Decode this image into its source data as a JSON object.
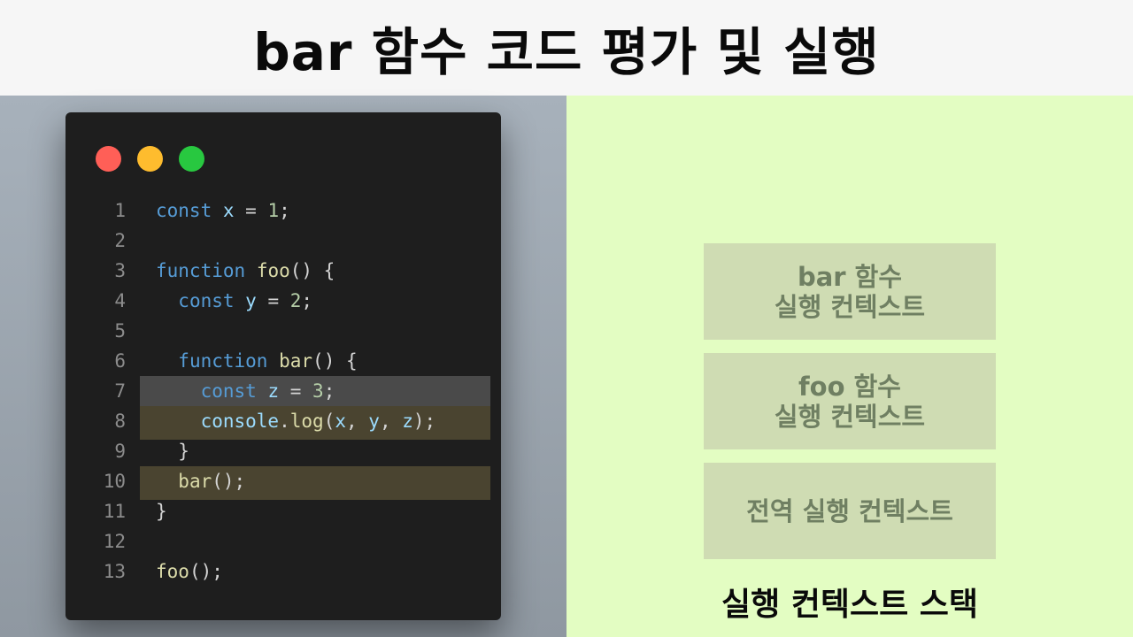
{
  "header": {
    "title": "bar 함수 코드 평가 및 실행"
  },
  "colors": {
    "header_bg": "#f6f6f6",
    "left_panel_bg": "#a0aab4",
    "editor_bg": "#1e1e1e",
    "right_panel_bg": "#e3fdc2",
    "stack_box_bg": "#cfdcb3",
    "stack_box_text": "#6f7f62",
    "highlight_current": "#4a4a4a",
    "highlight_pending": "#4a4430"
  },
  "editor": {
    "window_buttons": [
      {
        "name": "close-dot",
        "color": "#ff5f57"
      },
      {
        "name": "minimize-dot",
        "color": "#febc2e"
      },
      {
        "name": "maximize-dot",
        "color": "#28c840"
      }
    ],
    "lines": [
      {
        "num": "1",
        "highlight": "",
        "tokens": [
          [
            "kw",
            "const"
          ],
          [
            "pn",
            " "
          ],
          [
            "var",
            "x"
          ],
          [
            "pn",
            " = "
          ],
          [
            "numl",
            "1"
          ],
          [
            "pn",
            ";"
          ]
        ]
      },
      {
        "num": "2",
        "highlight": "",
        "tokens": []
      },
      {
        "num": "3",
        "highlight": "",
        "tokens": [
          [
            "kw",
            "function"
          ],
          [
            "pn",
            " "
          ],
          [
            "fn",
            "foo"
          ],
          [
            "pn",
            "() {"
          ]
        ]
      },
      {
        "num": "4",
        "highlight": "",
        "tokens": [
          [
            "pn",
            "  "
          ],
          [
            "kw",
            "const"
          ],
          [
            "pn",
            " "
          ],
          [
            "var",
            "y"
          ],
          [
            "pn",
            " = "
          ],
          [
            "numl",
            "2"
          ],
          [
            "pn",
            ";"
          ]
        ]
      },
      {
        "num": "5",
        "highlight": "",
        "tokens": []
      },
      {
        "num": "6",
        "highlight": "",
        "tokens": [
          [
            "pn",
            "  "
          ],
          [
            "kw",
            "function"
          ],
          [
            "pn",
            " "
          ],
          [
            "fn",
            "bar"
          ],
          [
            "pn",
            "() {"
          ]
        ]
      },
      {
        "num": "7",
        "highlight": "current",
        "tokens": [
          [
            "pn",
            "    "
          ],
          [
            "kw",
            "const"
          ],
          [
            "pn",
            " "
          ],
          [
            "var",
            "z"
          ],
          [
            "pn",
            " = "
          ],
          [
            "numl",
            "3"
          ],
          [
            "pn",
            ";"
          ]
        ]
      },
      {
        "num": "8",
        "highlight": "pending",
        "tokens": [
          [
            "pn",
            "    "
          ],
          [
            "var",
            "console"
          ],
          [
            "pn",
            "."
          ],
          [
            "fn",
            "log"
          ],
          [
            "pn",
            "("
          ],
          [
            "var",
            "x"
          ],
          [
            "pn",
            ", "
          ],
          [
            "var",
            "y"
          ],
          [
            "pn",
            ", "
          ],
          [
            "var",
            "z"
          ],
          [
            "pn",
            ");"
          ]
        ]
      },
      {
        "num": "9",
        "highlight": "",
        "tokens": [
          [
            "pn",
            "  }"
          ]
        ]
      },
      {
        "num": "10",
        "highlight": "pending",
        "tokens": [
          [
            "pn",
            "  "
          ],
          [
            "fn",
            "bar"
          ],
          [
            "pn",
            "();"
          ]
        ]
      },
      {
        "num": "11",
        "highlight": "",
        "tokens": [
          [
            "pn",
            "}"
          ]
        ]
      },
      {
        "num": "12",
        "highlight": "",
        "tokens": []
      },
      {
        "num": "13",
        "highlight": "",
        "tokens": [
          [
            "fn",
            "foo"
          ],
          [
            "pn",
            "();"
          ]
        ]
      }
    ]
  },
  "stack": {
    "label": "실행 컨텍스트 스택",
    "frames": [
      {
        "line1": "bar 함수",
        "line2": "실행 컨텍스트"
      },
      {
        "line1": "foo 함수",
        "line2": "실행 컨텍스트"
      },
      {
        "line1": "전역 실행 컨텍스트",
        "line2": ""
      }
    ]
  }
}
